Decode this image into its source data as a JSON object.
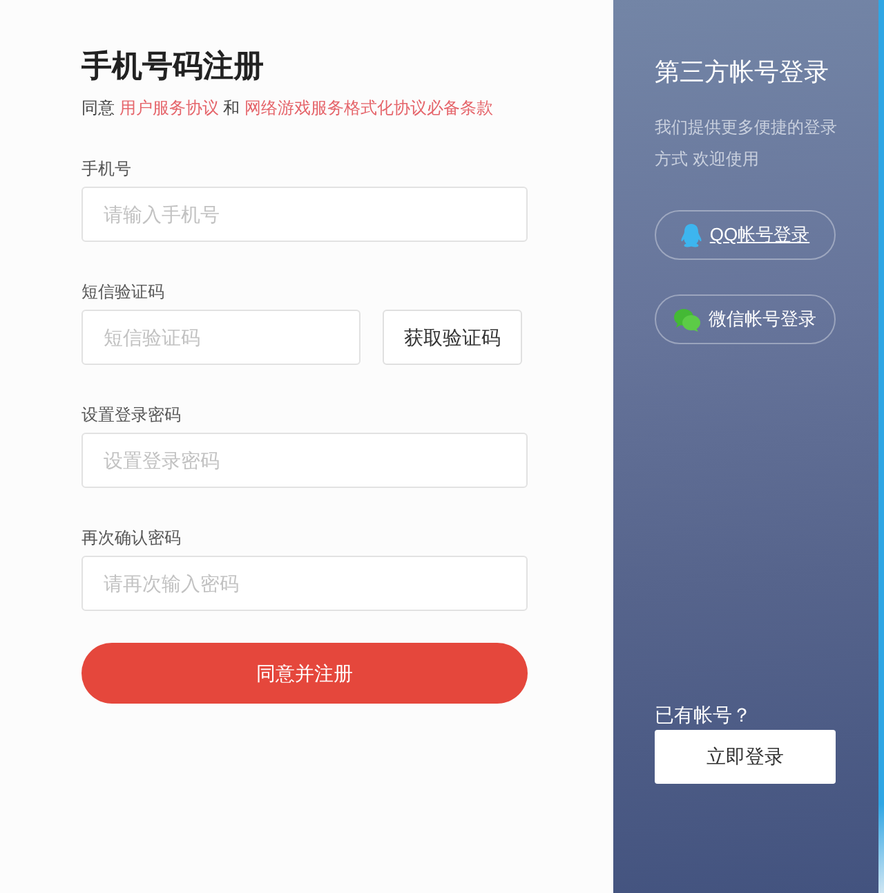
{
  "form": {
    "title": "手机号码注册",
    "agreement": [
      {
        "kind": "text",
        "text": "同意"
      },
      {
        "kind": "link",
        "text": "用户服务协议"
      },
      {
        "kind": "text",
        "text": "和"
      },
      {
        "kind": "link",
        "text": "网络游戏服务格式化协议必备条款"
      }
    ],
    "fields": [
      {
        "label": "手机号",
        "placeholder": "请输入手机号"
      },
      {
        "label": "短信验证码",
        "placeholder": "短信验证码",
        "button": "获取验证码"
      },
      {
        "label": "设置登录密码",
        "placeholder": "设置登录密码"
      },
      {
        "label": "再次确认密码",
        "placeholder": "请再次输入密码"
      }
    ],
    "submit": "同意并注册"
  },
  "third_party": {
    "title": "第三方帐号登录",
    "description": "我们提供更多便捷的登录方式 欢迎使用",
    "buttons": [
      {
        "kind": "qq",
        "label": "QQ帐号登录",
        "hovered": true
      },
      {
        "kind": "wechat",
        "label": "微信帐号登录",
        "hovered": false
      }
    ]
  },
  "login": {
    "prompt": "已有帐号？",
    "button": "立即登录"
  }
}
